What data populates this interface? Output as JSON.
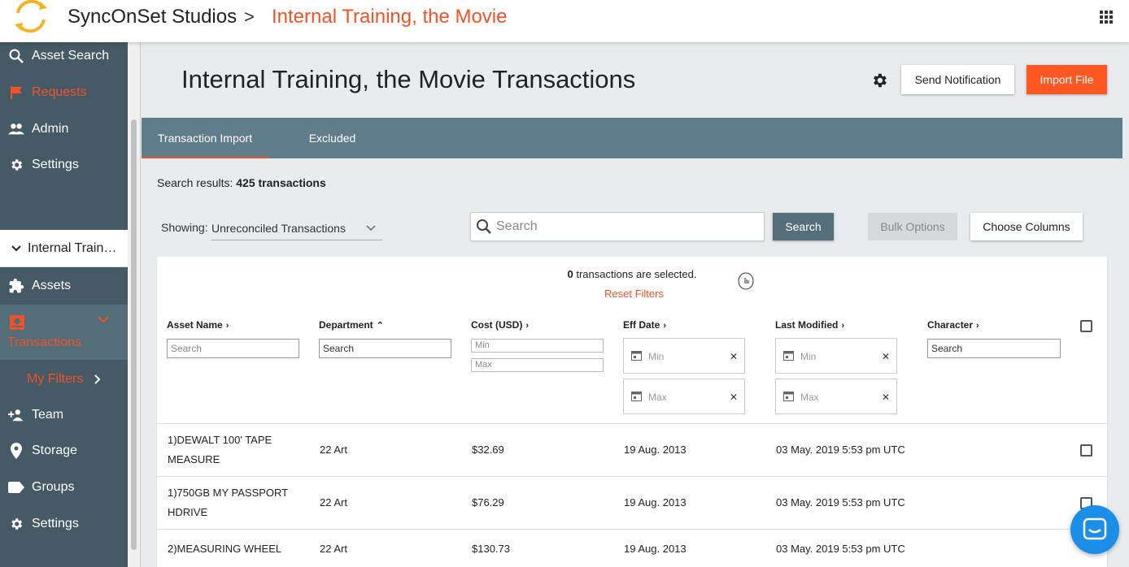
{
  "header": {
    "studio": "SyncOnSet Studios",
    "separator": ">",
    "project": "Internal Training, the Movie"
  },
  "sidebar": {
    "top_items": [
      {
        "label": "Asset Search",
        "icon": "search-icon"
      },
      {
        "label": "Requests",
        "icon": "flag-icon"
      },
      {
        "label": "Admin",
        "icon": "people-icon"
      },
      {
        "label": "Settings",
        "icon": "gear-icon"
      }
    ],
    "project_label": "Internal Train…",
    "assets": "Assets",
    "transactions": "Transactions",
    "my_filters": "My Filters",
    "bottom_items": [
      {
        "label": "Team",
        "icon": "add-person-icon"
      },
      {
        "label": "Storage",
        "icon": "location-pin-icon"
      },
      {
        "label": "Groups",
        "icon": "tag-icon"
      },
      {
        "label": "Settings",
        "icon": "gear-icon"
      }
    ]
  },
  "page": {
    "title": "Internal Training, the Movie Transactions",
    "send_notification": "Send Notification",
    "import_file": "Import File"
  },
  "tabs": [
    "Transaction Import",
    "Excluded"
  ],
  "results": {
    "prefix": "Search results: ",
    "count": "425 transactions"
  },
  "toolbar": {
    "showing_label": "Showing:",
    "showing_value": "Unreconciled Transactions",
    "search_placeholder": "Search",
    "search_button": "Search",
    "bulk_options": "Bulk Options",
    "choose_columns": "Choose Columns"
  },
  "selection": {
    "count": "0",
    "text": " transactions are selected.",
    "reset": "Reset Filters"
  },
  "columns": {
    "asset_name": "Asset Name",
    "department": "Department",
    "cost": "Cost (USD)",
    "eff_date": "Eff Date",
    "last_modified": "Last Modified",
    "character": "Character"
  },
  "filters": {
    "asset_placeholder": "Search",
    "department_value": "Search",
    "cost_min": "Min",
    "cost_max": "Max",
    "date_min": "Min",
    "date_max": "Max",
    "character_value": "Search"
  },
  "rows": [
    {
      "asset_line1": "1)DEWALT 100' TAPE",
      "asset_line2": "MEASURE",
      "department": "22 Art",
      "cost": "$32.69",
      "eff_date": "19 Aug. 2013",
      "last_modified": "03 May. 2019 5:53 pm UTC"
    },
    {
      "asset_line1": "1)750GB MY PASSPORT",
      "asset_line2": "HDRIVE",
      "department": "22 Art",
      "cost": "$76.29",
      "eff_date": "19 Aug. 2013",
      "last_modified": "03 May. 2019 5:53 pm UTC"
    },
    {
      "asset_line1": "2)MEASURING WHEEL",
      "asset_line2": "",
      "department": "22 Art",
      "cost": "$130.73",
      "eff_date": "19 Aug. 2013",
      "last_modified": "03 May. 2019 5:53 pm UTC"
    }
  ],
  "colors": {
    "accent": "#f0532a",
    "sidebar": "#455a64",
    "tabbar": "#607d8b",
    "import_button": "#ff5722"
  }
}
